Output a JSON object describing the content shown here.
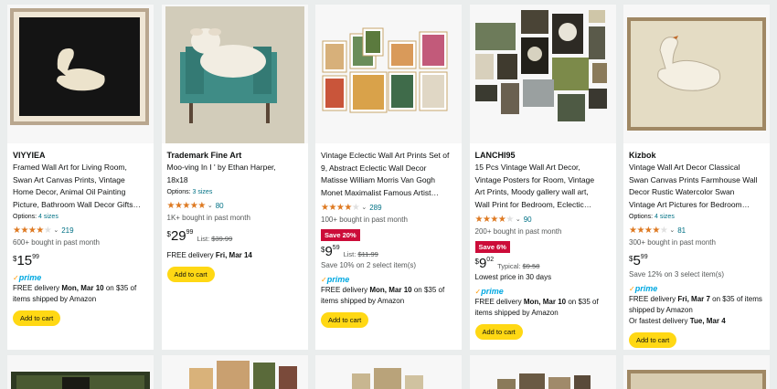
{
  "products": [
    {
      "brand": "VIYYIEA",
      "title_lines": [
        "Framed Wall Art for Living Room,",
        "Swan Art Canvas Prints, Vintage",
        "Home Decor, Animal Oil Painting",
        "Picture, Bathroom Wall Decor Gifts…"
      ],
      "options_label": "Options:",
      "options_value": "4 sizes",
      "rating": "4.5",
      "review_count": "219",
      "bought": "600+ bought in past month",
      "price_symbol": "$",
      "price_whole": "15",
      "price_fraction": "99",
      "prime": "prime",
      "delivery_prefix": "FREE delivery ",
      "delivery_date": "Mon, Mar 10",
      "delivery_suffix": " on $35 of",
      "delivery_line2": "items shipped by Amazon",
      "cart_label": "Add to cart"
    },
    {
      "brand": "Trademark Fine Art",
      "title_lines": [
        "Moo-ving In I ' by Ethan Harper,",
        "18x18"
      ],
      "options_label": "Options:",
      "options_value": "3 sizes",
      "rating": "4.8",
      "review_count": "80",
      "bought": "1K+ bought in past month",
      "price_symbol": "$",
      "price_whole": "29",
      "price_fraction": "99",
      "list_label": "List:",
      "list_price": "$39.99",
      "delivery_prefix": "FREE delivery ",
      "delivery_date": "Fri, Mar 14",
      "cart_label": "Add to cart"
    },
    {
      "title_lines": [
        "Vintage Eclectic Wall Art Prints Set of",
        "9, Abstract Eclectic Wall Decor",
        "Matisse William Morris Van Gogh",
        "Monet Maximalist Famous Artist…"
      ],
      "rating": "4.5",
      "review_count": "289",
      "bought": "100+ bought in past month",
      "badge": "Save 20%",
      "price_symbol": "$",
      "price_whole": "9",
      "price_fraction": "59",
      "list_label": "List:",
      "list_price": "$11.99",
      "save_note": "Save 10% on 2 select item(s)",
      "prime": "prime",
      "delivery_prefix": "FREE delivery ",
      "delivery_date": "Mon, Mar 10",
      "delivery_suffix": " on $35 of",
      "delivery_line2": "items shipped by Amazon",
      "cart_label": "Add to cart"
    },
    {
      "brand": "LANCHI95",
      "title_lines": [
        "15 Pcs Vintage Wall Art Decor,",
        "Vintage Posters for Room, Vintage",
        "Art Prints, Moody gallery wall art,",
        "Wall Print for Bedroom, Eclectic…"
      ],
      "rating": "4.5",
      "review_count": "90",
      "bought": "200+ bought in past month",
      "badge": "Save 6%",
      "price_symbol": "$",
      "price_whole": "9",
      "price_fraction": "02",
      "typical_label": "Typical:",
      "typical_price": "$9.58",
      "lowest_note": "Lowest price in 30 days",
      "prime": "prime",
      "delivery_prefix": "FREE delivery ",
      "delivery_date": "Mon, Mar 10",
      "delivery_suffix": " on $35 of",
      "delivery_line2": "items shipped by Amazon",
      "cart_label": "Add to cart"
    },
    {
      "brand": "Kizbok",
      "title_lines": [
        "Vintage Wall Art Decor Classical",
        "Swan Canvas Prints Farmhouse Wall",
        "Decor Rustic Watercolor Swan",
        "Vintage Art Pictures for Bedroom…"
      ],
      "options_label": "Options:",
      "options_value": "4 sizes",
      "rating": "4.5",
      "review_count": "81",
      "bought": "300+ bought in past month",
      "price_symbol": "$",
      "price_whole": "5",
      "price_fraction": "99",
      "save_note": "Save 12% on 3 select item(s)",
      "prime": "prime",
      "delivery_prefix": "FREE delivery ",
      "delivery_date": "Fri, Mar 7",
      "delivery_suffix": " on $35 of items",
      "delivery_line2": "shipped by Amazon",
      "fastest_prefix": "Or fastest delivery ",
      "fastest_date": "Tue, Mar 4",
      "cart_label": "Add to cart"
    }
  ],
  "colors": {
    "star": "#de7921",
    "link": "#007185",
    "badge": "#cc0c39",
    "cart": "#ffd814",
    "prime": "#00a8e1"
  }
}
